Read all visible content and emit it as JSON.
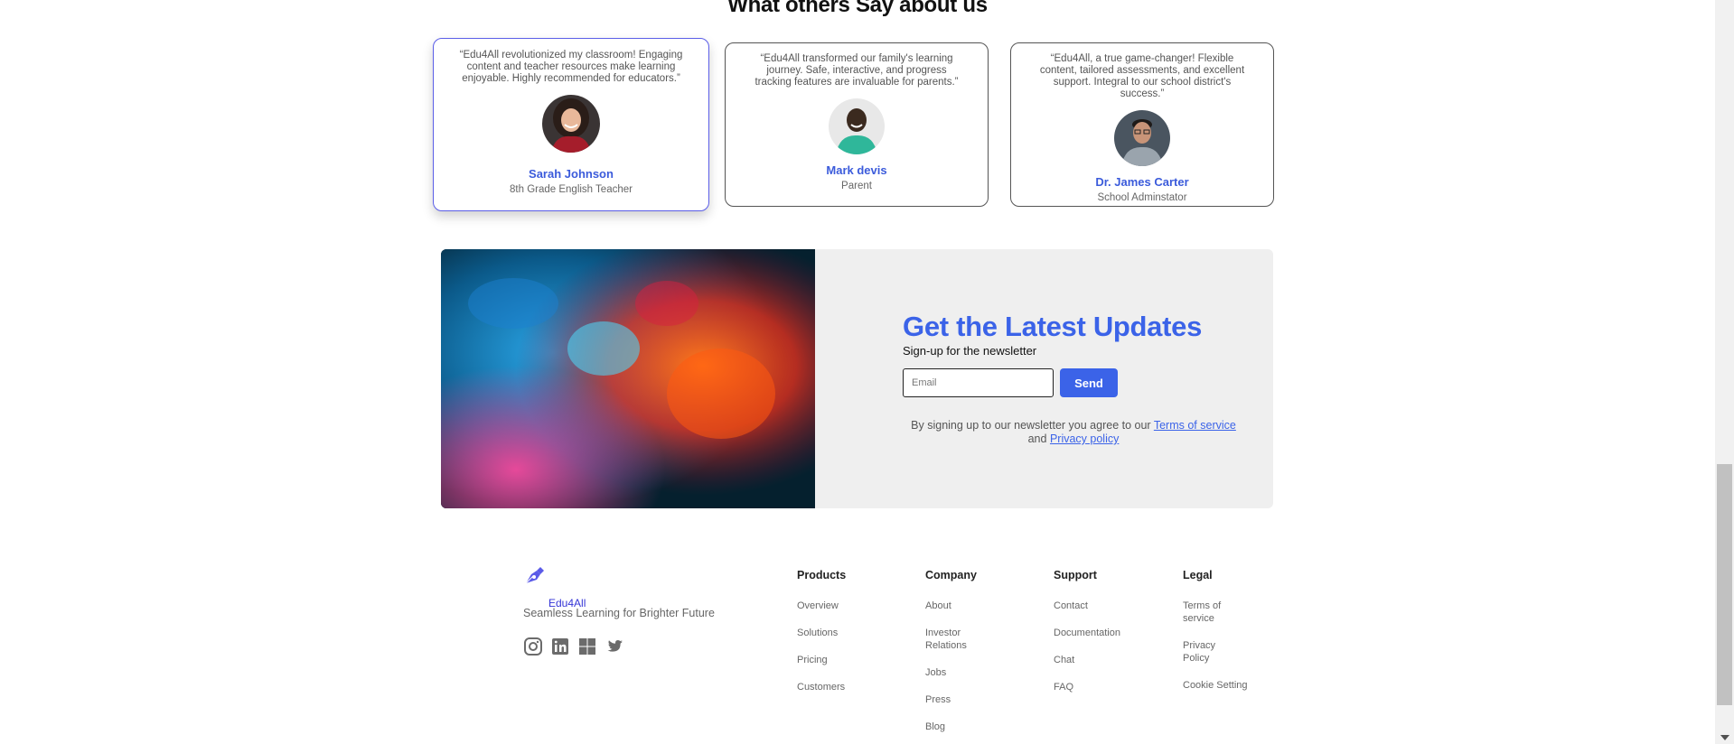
{
  "testimonials": {
    "title": "What others Say about us",
    "cards": [
      {
        "quote": "“Edu4All revolutionized my classroom! Engaging content and teacher resources make learning enjoyable. Highly recommended for educators.”",
        "name": "Sarah Johnson",
        "role": "8th Grade English Teacher"
      },
      {
        "quote": "“Edu4All transformed our family's learning journey. Safe, interactive, and progress tracking features are invaluable for parents.”",
        "name": "Mark devis",
        "role": "Parent"
      },
      {
        "quote": "“Edu4All, a true game-changer! Flexible content, tailored assessments, and excellent support. Integral to our school district's success.”",
        "name": "Dr. James Carter",
        "role": "School Adminstator"
      }
    ]
  },
  "newsletter": {
    "title": "Get the Latest Updates",
    "subtitle": "Sign-up for the newsletter",
    "email_placeholder": "Email",
    "email_value": "",
    "send_label": "Send",
    "terms_prefix": "By signing up to our newsletter you agree to our ",
    "terms_link": "Terms of service ",
    "terms_and": "and ",
    "privacy_link": "Privacy policy",
    "accent_color": "#3b63e8"
  },
  "footer": {
    "brand_name": "Edu4All",
    "tagline": "Seamless Learning for Brighter Future",
    "socials": [
      "instagram-icon",
      "linkedin-icon",
      "windows-icon",
      "twitter-icon"
    ],
    "columns": [
      {
        "heading": "Products",
        "links": [
          "Overview",
          "Solutions",
          "Pricing",
          "Customers"
        ]
      },
      {
        "heading": "Company",
        "links": [
          "About",
          "Investor Relations",
          "Jobs",
          "Press",
          "Blog"
        ]
      },
      {
        "heading": "Support",
        "links": [
          "Contact",
          "Documentation",
          "Chat",
          "FAQ"
        ]
      },
      {
        "heading": "Legal",
        "links": [
          "Terms of service",
          "Privacy Policy",
          "Cookie Setting"
        ]
      }
    ]
  }
}
